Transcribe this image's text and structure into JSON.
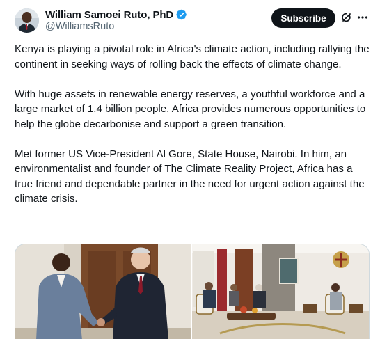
{
  "post": {
    "author": {
      "display_name": "William Samoei Ruto, PhD",
      "handle": "@WilliamsRuto",
      "verified": true,
      "avatar_icon": "avatar-photo"
    },
    "actions": {
      "subscribe_label": "Subscribe",
      "grok_icon": "grok-icon",
      "more_icon": "more-options-icon"
    },
    "text": {
      "paragraph_1": "Kenya is playing a pivotal role in Africa's climate action, including rallying the continent in seeking ways of rolling back the effects of climate change.",
      "paragraph_2": "With huge assets in renewable energy reserves, a youthful workforce and a large market of 1.4 billion people, Africa provides numerous opportunities to help the globe decarbonise and support a green transition.",
      "paragraph_3": "Met former US Vice-President Al Gore, State House, Nairobi. In him, an environmentalist and founder of The Climate Reality Project, Africa has a true friend and dependable partner in the need for urgent action against the climate crisis."
    },
    "media": [
      {
        "kind": "photo",
        "subject": "handshake-photo"
      },
      {
        "kind": "photo",
        "subject": "meeting-room-photo"
      }
    ]
  },
  "colors": {
    "text_primary": "#0f1419",
    "text_secondary": "#536471",
    "verified_blue": "#1d9bf0",
    "subscribe_bg": "#0f1419",
    "border": "#cfd9de"
  }
}
